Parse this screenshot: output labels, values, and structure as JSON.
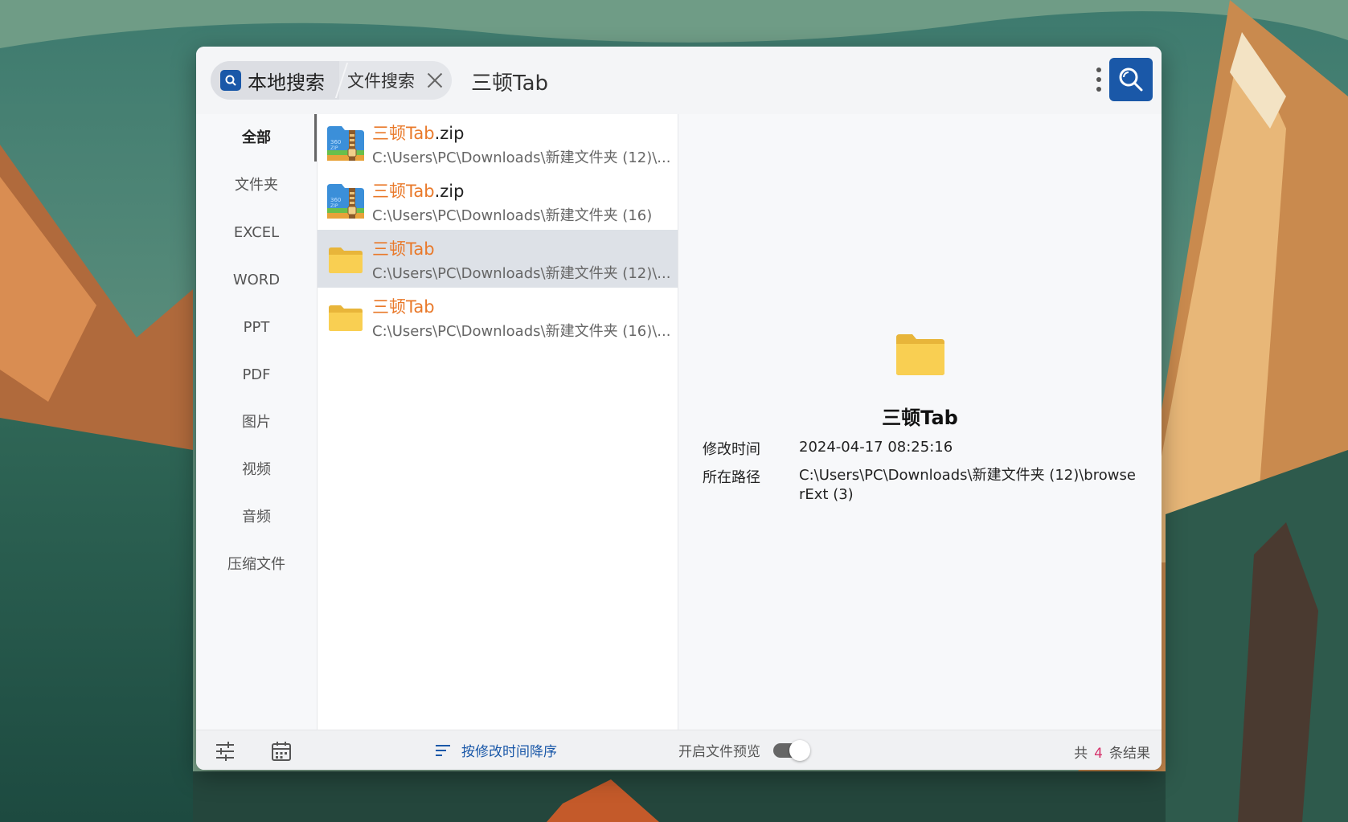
{
  "search": {
    "scope_local": "本地搜索",
    "scope_file": "文件搜索",
    "query": "三顿Tab"
  },
  "sidebar": {
    "categories": [
      "全部",
      "文件夹",
      "EXCEL",
      "WORD",
      "PPT",
      "PDF",
      "图片",
      "视频",
      "音频",
      "压缩文件"
    ],
    "active": "全部"
  },
  "results": [
    {
      "name_hl": "三顿Tab",
      "name_rest": ".zip",
      "path": "C:\\Users\\PC\\Downloads\\新建文件夹 (12)\\...",
      "icon": "zip-archive-icon"
    },
    {
      "name_hl": "三顿Tab",
      "name_rest": ".zip",
      "path": "C:\\Users\\PC\\Downloads\\新建文件夹 (16)",
      "icon": "zip-archive-icon"
    },
    {
      "name_hl": "三顿Tab",
      "name_rest": "",
      "path": "C:\\Users\\PC\\Downloads\\新建文件夹 (12)\\...",
      "icon": "folder-icon",
      "selected": true
    },
    {
      "name_hl": "三顿Tab",
      "name_rest": "",
      "path": "C:\\Users\\PC\\Downloads\\新建文件夹 (16)\\...",
      "icon": "folder-icon"
    }
  ],
  "preview": {
    "title": "三顿Tab",
    "modified_label": "修改时间",
    "modified_value": "2024-04-17 08:25:16",
    "path_label": "所在路径",
    "path_value": "C:\\Users\\PC\\Downloads\\新建文件夹 (12)\\browserExt (3)"
  },
  "bottom": {
    "sort_label": "按修改时间降序",
    "preview_label": "开启文件预览",
    "count_prefix": "共",
    "count": "4",
    "count_suffix": "条结果"
  },
  "colors": {
    "accent": "#1a58a8",
    "highlight": "#e9792a",
    "count": "#d6336c",
    "folder": "#f9cf52"
  }
}
